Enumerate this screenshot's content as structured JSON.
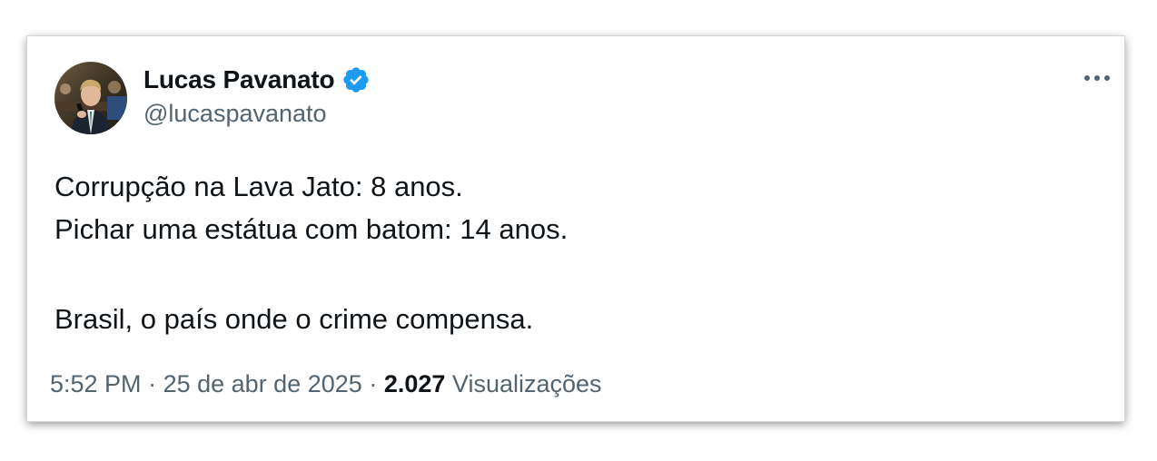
{
  "author": {
    "display_name": "Lucas Pavanato",
    "handle": "@lucaspavanato",
    "verified_icon": "verified-badge-icon",
    "verified_color": "#1d9bf0"
  },
  "tweet": {
    "lines": [
      "Corrupção na Lava Jato: 8 anos.",
      "Pichar uma estátua com batom: 14 anos.",
      "Brasil, o país onde o crime compensa."
    ]
  },
  "meta": {
    "time": "5:52 PM",
    "separator": "·",
    "date": "25 de abr de 2025",
    "views_count": "2.027",
    "views_label": "Visualizações"
  },
  "menu": {
    "icon": "more-options-icon"
  }
}
